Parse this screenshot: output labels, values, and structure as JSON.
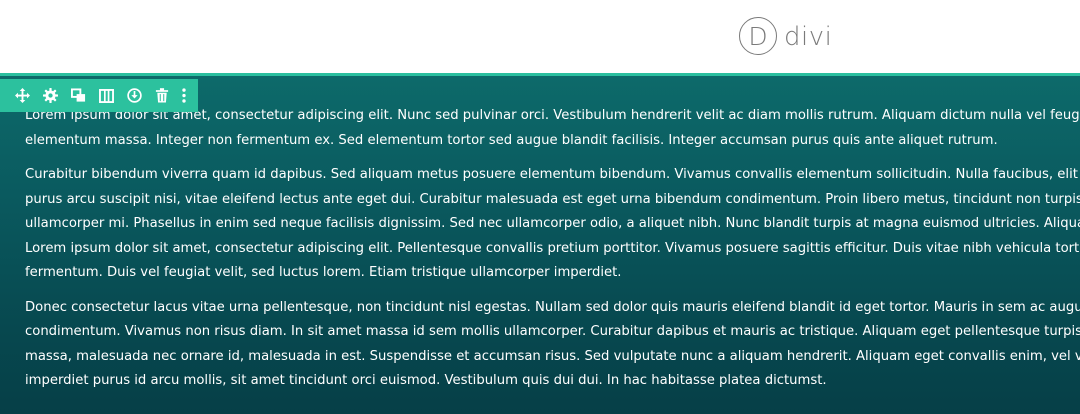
{
  "header": {
    "logo_letter": "D",
    "logo_word": "divi"
  },
  "toolbar": {
    "items": [
      {
        "icon": "move-icon",
        "label": "Move"
      },
      {
        "icon": "gear-icon",
        "label": "Settings"
      },
      {
        "icon": "duplicate-icon",
        "label": "Duplicate"
      },
      {
        "icon": "columns-icon",
        "label": "Change Structure"
      },
      {
        "icon": "save-icon",
        "label": "Save to Library"
      },
      {
        "icon": "trash-icon",
        "label": "Delete"
      },
      {
        "icon": "more-icon",
        "label": "More"
      }
    ],
    "bg_color": "#2cc19e"
  },
  "section": {
    "bg_color": "#085259",
    "accent_color": "#2bbf9f",
    "paragraphs": [
      [
        "Lorem ipsum dolor sit amet, consectetur adipiscing elit. Nunc sed pulvinar orci. Vestibulum hendrerit velit ac diam mollis rutrum. Aliquam dictum nulla vel feugiat",
        "elementum massa. Integer non fermentum ex. Sed elementum tortor sed augue blandit facilisis. Integer accumsan purus quis ante aliquet rutrum."
      ],
      [
        "Curabitur bibendum viverra quam id dapibus. Sed aliquam metus posuere elementum bibendum. Vivamus convallis elementum sollicitudin. Nulla faucibus, elit at",
        "purus arcu suscipit nisi, vitae eleifend lectus ante eget dui. Curabitur malesuada est eget urna bibendum condimentum. Proin libero metus, tincidunt non turpis si",
        "ullamcorper mi. Phasellus in enim sed neque facilisis dignissim. Sed nec ullamcorper odio, a aliquet nibh. Nunc blandit turpis at magna euismod ultricies. Aliquam",
        "Lorem ipsum dolor sit amet, consectetur adipiscing elit. Pellentesque convallis pretium porttitor. Vivamus posuere sagittis efficitur. Duis vitae nibh vehicula tortor a",
        "fermentum. Duis vel feugiat velit, sed luctus lorem. Etiam tristique ullamcorper imperdiet."
      ],
      [
        "Donec consectetur lacus vitae urna pellentesque, non tincidunt nisl egestas. Nullam sed dolor quis mauris eleifend blandit id eget tortor. Mauris in sem ac augue e",
        "condimentum. Vivamus non risus diam. In sit amet massa id sem mollis ullamcorper. Curabitur dapibus et mauris ac tristique. Aliquam eget pellentesque turpis. P",
        "massa, malesuada nec ornare id, malesuada in est. Suspendisse et accumsan risus. Sed vulputate nunc a aliquam hendrerit. Aliquam eget convallis enim, vel volut",
        "imperdiet purus id arcu mollis, sit amet tincidunt orci euismod. Vestibulum quis dui dui. In hac habitasse platea dictumst."
      ]
    ]
  }
}
